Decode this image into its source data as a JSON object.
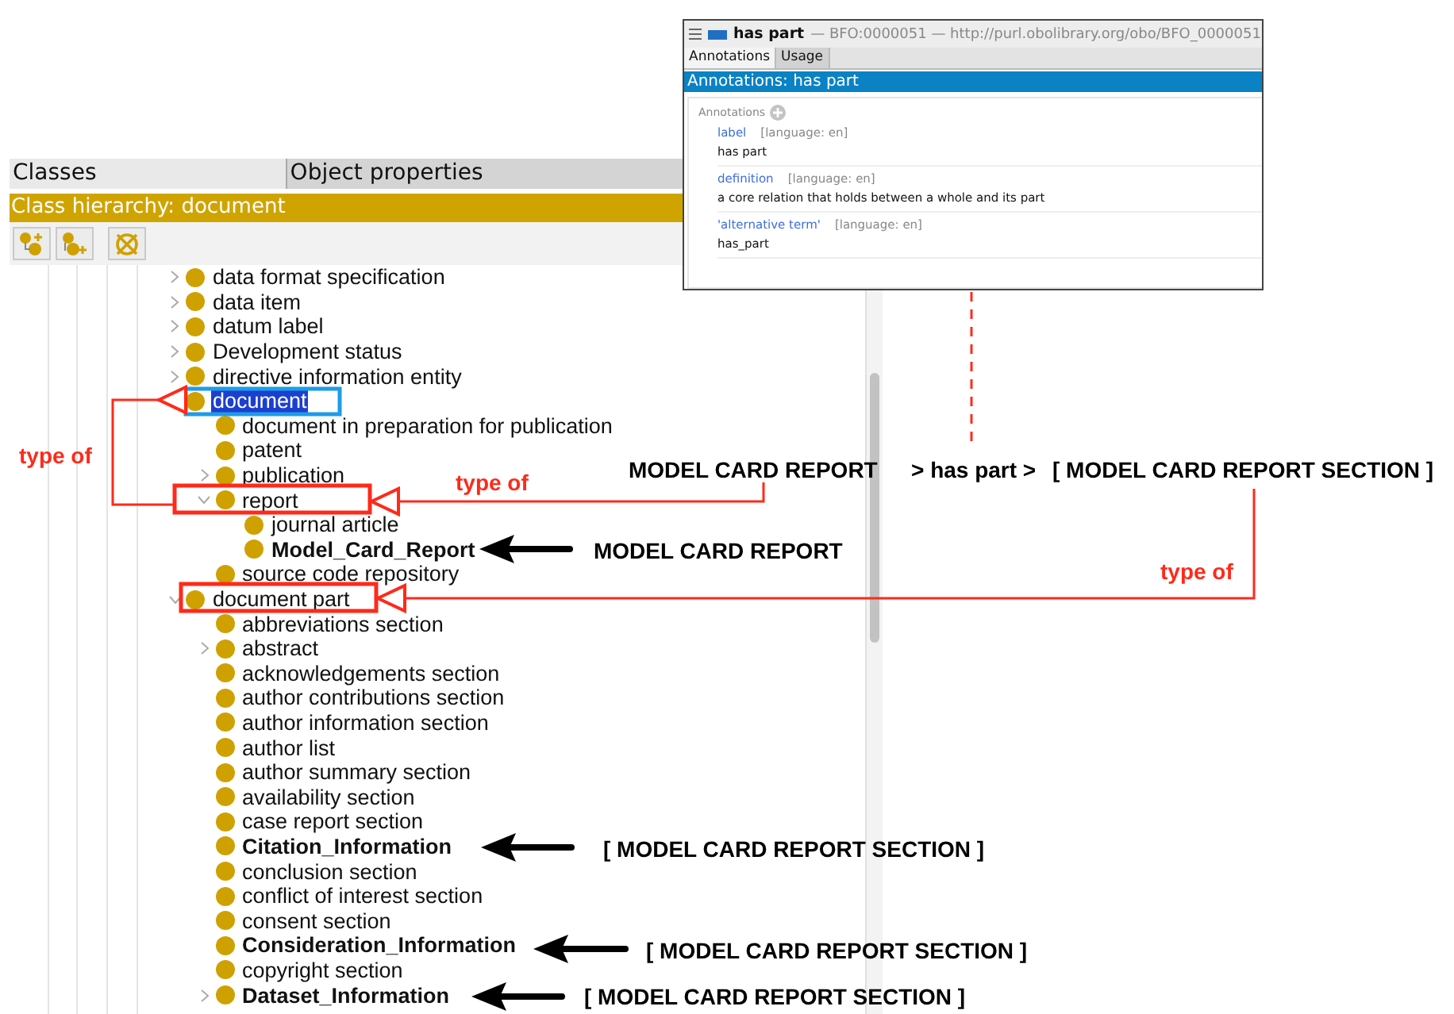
{
  "tabs": [
    {
      "label": "Classes",
      "selected": true
    },
    {
      "label": "Object properties",
      "selected": false
    }
  ],
  "hierarchy_title": "Class hierarchy: document",
  "tree": [
    {
      "label": "data format specification",
      "expanded": false,
      "selected": false,
      "bold": false
    },
    {
      "label": "data item",
      "expanded": false,
      "selected": false,
      "bold": false
    },
    {
      "label": "datum label",
      "expanded": false,
      "selected": false,
      "bold": false
    },
    {
      "label": "Development status",
      "expanded": false,
      "selected": false,
      "bold": false
    },
    {
      "label": "directive information entity",
      "expanded": false,
      "selected": false,
      "bold": false
    },
    {
      "label": "document",
      "selected": true,
      "bold": false,
      "children": [
        {
          "label": "document in preparation for publication",
          "selected": false,
          "bold": false
        },
        {
          "label": "patent",
          "selected": false,
          "bold": false
        },
        {
          "label": "publication",
          "expanded": false,
          "selected": false,
          "bold": false
        },
        {
          "label": "report",
          "expanded": true,
          "selected": false,
          "bold": false,
          "children": [
            {
              "label": "journal article",
              "selected": false,
              "bold": false
            },
            {
              "label": "Model_Card_Report",
              "selected": false,
              "bold": true
            }
          ]
        },
        {
          "label": "source code repository",
          "selected": false,
          "bold": false
        }
      ]
    },
    {
      "label": "document part",
      "expanded": true,
      "selected": false,
      "bold": false,
      "children": [
        {
          "label": "abbreviations section",
          "selected": false,
          "bold": false
        },
        {
          "label": "abstract",
          "expanded": false,
          "selected": false,
          "bold": false
        },
        {
          "label": "acknowledgements section",
          "selected": false,
          "bold": false
        },
        {
          "label": "author contributions section",
          "selected": false,
          "bold": false
        },
        {
          "label": "author information section",
          "selected": false,
          "bold": false
        },
        {
          "label": "author list",
          "selected": false,
          "bold": false
        },
        {
          "label": "author summary section",
          "selected": false,
          "bold": false
        },
        {
          "label": "availability section",
          "selected": false,
          "bold": false
        },
        {
          "label": "case report section",
          "selected": false,
          "bold": false
        },
        {
          "label": "Citation_Information",
          "selected": false,
          "bold": true
        },
        {
          "label": "conclusion section",
          "selected": false,
          "bold": false
        },
        {
          "label": "conflict of interest section",
          "selected": false,
          "bold": false
        },
        {
          "label": "consent section",
          "selected": false,
          "bold": false
        },
        {
          "label": "Consideration_Information",
          "selected": false,
          "bold": true
        },
        {
          "label": "copyright section",
          "selected": false,
          "bold": false
        },
        {
          "label": "Dataset_Information",
          "expanded": false,
          "selected": false,
          "bold": true
        }
      ]
    }
  ],
  "popup": {
    "name": "has part",
    "ids": "— BFO:0000051 — http://purl.obolibrary.org/obo/BFO_0000051",
    "tabs": [
      {
        "label": "Annotations",
        "selected": true
      },
      {
        "label": "Usage",
        "selected": false
      }
    ],
    "header": "Annotations: has part",
    "section": "Annotations",
    "entries": [
      {
        "property": "label",
        "language": "[language: en]",
        "value": "has part"
      },
      {
        "property": "definition",
        "language": "[language: en]",
        "value": "a core relation that holds between a whole and its part"
      },
      {
        "property": "'alternative term'",
        "language": "[language: en]",
        "value": "has_part"
      }
    ]
  },
  "annotations": [
    {
      "text": "type of",
      "color": "#ff2a1a"
    },
    {
      "text": "type of",
      "color": "#ff2a1a"
    },
    {
      "text": "MODEL CARD REPORT",
      "color": "#000000"
    },
    {
      "text": "> has part >",
      "color": "#000000"
    },
    {
      "text": "[ MODEL CARD REPORT SECTION ]",
      "color": "#000000"
    },
    {
      "text": "MODEL CARD REPORT",
      "color": "#000000"
    },
    {
      "text": "type of",
      "color": "#ff2a1a"
    },
    {
      "text": "[ MODEL CARD REPORT SECTION ]",
      "color": "#000000"
    },
    {
      "text": "[ MODEL CARD REPORT SECTION ]",
      "color": "#000000"
    },
    {
      "text": "[ MODEL CARD REPORT SECTION ]",
      "color": "#000000"
    }
  ]
}
